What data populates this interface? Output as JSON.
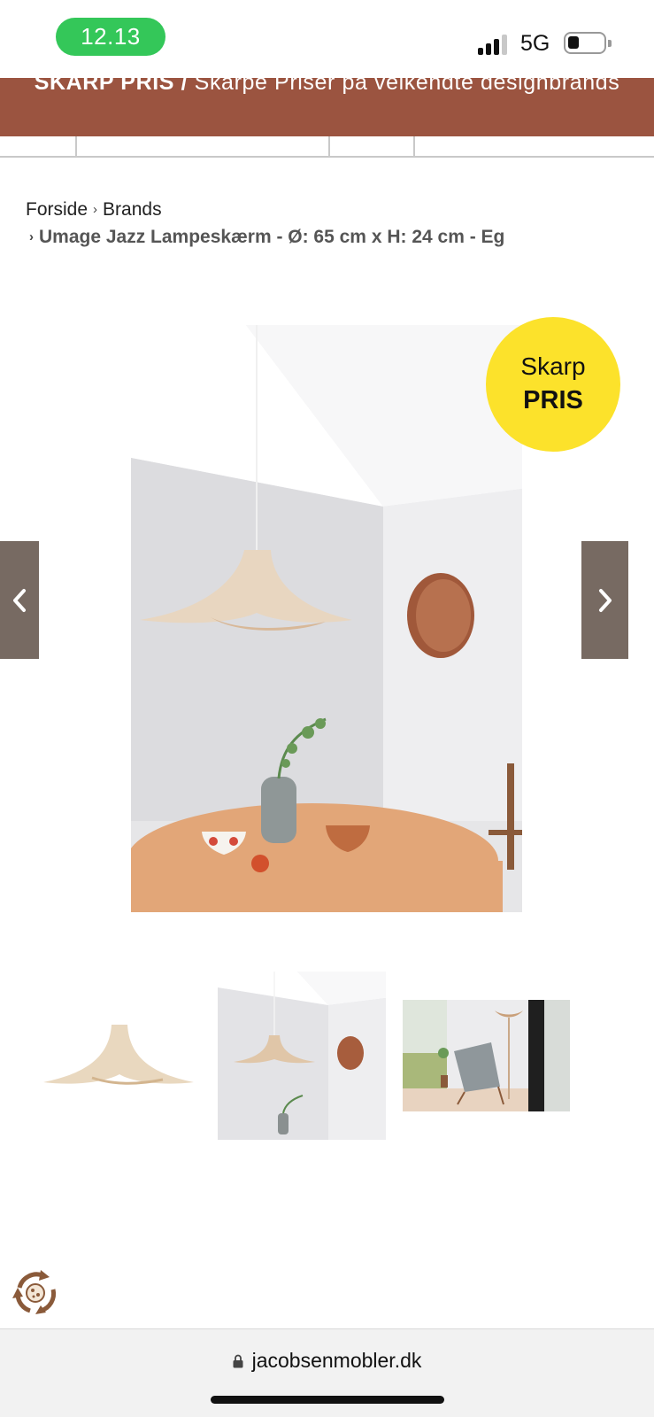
{
  "status_bar": {
    "time": "12.13",
    "network": "5G"
  },
  "promo": {
    "bold_text": "SKARP PRIS /",
    "text": " Skarpe Priser på velkendte designbrands",
    "background_color": "#9b5440"
  },
  "breadcrumb": {
    "items": [
      "Forside",
      "Brands"
    ],
    "separator": "›",
    "current": "Umage Jazz Lampeskærm - Ø: 65 cm x H: 24 cm - Eg"
  },
  "badge": {
    "line1": "Skarp",
    "line2": "PRIS",
    "color": "#fce22b"
  },
  "gallery": {
    "prev_icon": "chevron-left-icon",
    "next_icon": "chevron-right-icon",
    "thumbnails": [
      "thumbnail-lamp-product",
      "thumbnail-lamp-room",
      "thumbnail-lamp-livingroom"
    ]
  },
  "browser": {
    "url": "jacobsenmobler.dk",
    "icon": "lock-icon"
  },
  "cookie_widget": {
    "icon": "cookie-consent-icon"
  }
}
